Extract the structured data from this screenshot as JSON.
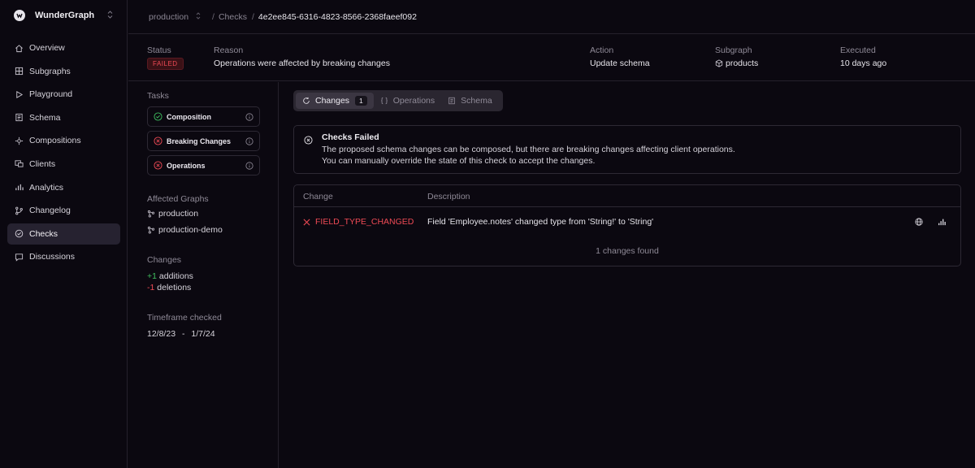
{
  "brand": {
    "name": "WunderGraph",
    "switcher_icon": "chevron-up-down-icon"
  },
  "nav": [
    {
      "label": "Overview",
      "icon": "home-icon",
      "active": false
    },
    {
      "label": "Subgraphs",
      "icon": "grid-icon",
      "active": false
    },
    {
      "label": "Playground",
      "icon": "play-icon",
      "active": false
    },
    {
      "label": "Schema",
      "icon": "file-icon",
      "active": false
    },
    {
      "label": "Compositions",
      "icon": "compositions-icon",
      "active": false
    },
    {
      "label": "Clients",
      "icon": "clients-icon",
      "active": false
    },
    {
      "label": "Analytics",
      "icon": "bar-chart-icon",
      "active": false
    },
    {
      "label": "Changelog",
      "icon": "git-icon",
      "active": false
    },
    {
      "label": "Checks",
      "icon": "check-circle-icon",
      "active": true
    },
    {
      "label": "Discussions",
      "icon": "chat-icon",
      "active": false
    }
  ],
  "breadcrumb": {
    "namespace": "production",
    "section": "Checks",
    "separator": "/",
    "check_id": "4e2ee845-6316-4823-8566-2368faeef092"
  },
  "summary": {
    "status_label": "Status",
    "status_value": "FAILED",
    "reason_label": "Reason",
    "reason_value": "Operations were affected by breaking changes",
    "action_label": "Action",
    "action_value": "Update schema",
    "subgraph_label": "Subgraph",
    "subgraph_value": "products",
    "executed_label": "Executed",
    "executed_value": "10 days ago"
  },
  "tasks": {
    "title": "Tasks",
    "items": [
      {
        "label": "Composition",
        "status": "passed"
      },
      {
        "label": "Breaking Changes",
        "status": "failed"
      },
      {
        "label": "Operations",
        "status": "failed"
      }
    ]
  },
  "affected_graphs": {
    "title": "Affected Graphs",
    "items": [
      "production",
      "production-demo"
    ]
  },
  "changes_summary": {
    "title": "Changes",
    "additions_count": "+1",
    "additions_label": "additions",
    "deletions_count": "-1",
    "deletions_label": "deletions"
  },
  "timeframe": {
    "title": "Timeframe checked",
    "start": "12/8/23",
    "separator": "-",
    "end": "1/7/24"
  },
  "tabs": [
    {
      "label": "Changes",
      "count": "1",
      "active": true,
      "icon": "refresh-icon"
    },
    {
      "label": "Operations",
      "active": false,
      "icon": "braces-icon"
    },
    {
      "label": "Schema",
      "active": false,
      "icon": "document-icon"
    }
  ],
  "alert": {
    "title": "Checks Failed",
    "line1": "The proposed schema changes can be composed, but there are breaking changes affecting client operations.",
    "line2": "You can manually override the state of this check to accept the changes."
  },
  "changes_table": {
    "headers": {
      "change": "Change",
      "description": "Description"
    },
    "rows": [
      {
        "change": "FIELD_TYPE_CHANGED",
        "description": "Field 'Employee.notes' changed type from 'String!' to 'String'"
      }
    ],
    "footer": "1 changes found"
  },
  "colors": {
    "background": "#0b0810",
    "border": "#25212b",
    "danger": "#ef4a55",
    "success": "#3fbf5f",
    "active_nav": "#262230"
  }
}
